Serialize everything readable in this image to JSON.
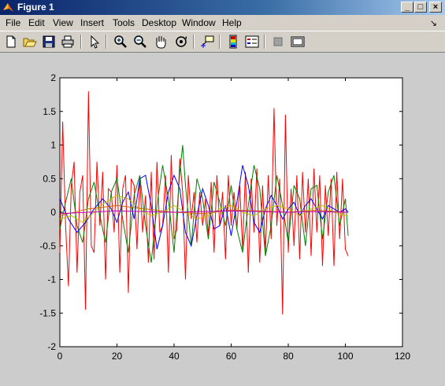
{
  "window": {
    "title": "Figure 1"
  },
  "menubar": {
    "items": [
      "File",
      "Edit",
      "View",
      "Insert",
      "Tools",
      "Desktop",
      "Window",
      "Help"
    ]
  },
  "toolbar": {
    "tools": [
      "new-figure",
      "open-file",
      "save",
      "print",
      "edit-plot",
      "zoom-in",
      "zoom-out",
      "pan",
      "rotate-3d",
      "data-cursor",
      "insert-colorbar",
      "insert-legend",
      "hide-plot-tools",
      "show-plot-tools"
    ]
  },
  "colors": {
    "blue": "#0000ff",
    "green": "#008000",
    "red": "#ff0000",
    "purple": "#bf00bf",
    "olive": "#bfbf00",
    "orange": "#cc6600"
  },
  "chart_data": {
    "type": "line",
    "title": "",
    "xlabel": "",
    "ylabel": "",
    "xlim": [
      0,
      120
    ],
    "ylim": [
      -2,
      2
    ],
    "x_ticks": [
      "0",
      "20",
      "40",
      "60",
      "80",
      "100",
      "120"
    ],
    "y_ticks": [
      "-2",
      "-1.5",
      "-1",
      "-0.5",
      "0",
      "0.5",
      "1",
      "1.5",
      "2"
    ],
    "grid": false,
    "series": [
      {
        "color": "red",
        "points": [
          [
            0,
            -0.6
          ],
          [
            1,
            1.35
          ],
          [
            2,
            -0.2
          ],
          [
            3,
            -1.1
          ],
          [
            4,
            0.4
          ],
          [
            5,
            0.75
          ],
          [
            6,
            -0.9
          ],
          [
            7,
            0.3
          ],
          [
            8,
            0.55
          ],
          [
            9,
            -1.45
          ],
          [
            10,
            1.8
          ],
          [
            11,
            -0.5
          ],
          [
            12,
            -0.6
          ],
          [
            13,
            0.75
          ],
          [
            14,
            -0.2
          ],
          [
            15,
            0.6
          ],
          [
            16,
            -1.0
          ],
          [
            17,
            0.35
          ],
          [
            18,
            0.3
          ],
          [
            19,
            -0.3
          ],
          [
            20,
            0.7
          ],
          [
            21,
            -0.9
          ],
          [
            22,
            0.35
          ],
          [
            23,
            0.55
          ],
          [
            24,
            -1.2
          ],
          [
            25,
            0.5
          ],
          [
            26,
            0.4
          ],
          [
            27,
            -0.55
          ],
          [
            28,
            0.5
          ],
          [
            29,
            -0.3
          ],
          [
            30,
            0.25
          ],
          [
            31,
            -0.75
          ],
          [
            32,
            0.6
          ],
          [
            33,
            -0.7
          ],
          [
            34,
            0.75
          ],
          [
            35,
            -0.3
          ],
          [
            36,
            -0.2
          ],
          [
            37,
            0.55
          ],
          [
            38,
            -0.9
          ],
          [
            39,
            0.85
          ],
          [
            40,
            -0.4
          ],
          [
            41,
            -0.25
          ],
          [
            42,
            0.8
          ],
          [
            43,
            0.3
          ],
          [
            44,
            -1.0
          ],
          [
            45,
            0.55
          ],
          [
            46,
            -0.1
          ],
          [
            47,
            0.3
          ],
          [
            48,
            -0.45
          ],
          [
            49,
            0.3
          ],
          [
            50,
            -0.2
          ],
          [
            51,
            0.2
          ],
          [
            52,
            -0.35
          ],
          [
            53,
            0.45
          ],
          [
            54,
            -0.6
          ],
          [
            55,
            0.55
          ],
          [
            56,
            -0.2
          ],
          [
            57,
            0.3
          ],
          [
            58,
            -0.7
          ],
          [
            59,
            0.55
          ],
          [
            60,
            -0.2
          ],
          [
            61,
            0.3
          ],
          [
            62,
            -0.25
          ],
          [
            63,
            0.4
          ],
          [
            64,
            -0.55
          ],
          [
            65,
            0.6
          ],
          [
            66,
            -0.9
          ],
          [
            67,
            0.5
          ],
          [
            68,
            -0.3
          ],
          [
            69,
            0.65
          ],
          [
            70,
            -0.75
          ],
          [
            71,
            0.4
          ],
          [
            72,
            -0.6
          ],
          [
            73,
            0.55
          ],
          [
            74,
            -0.4
          ],
          [
            75,
            1.55
          ],
          [
            76,
            -0.2
          ],
          [
            77,
            0.5
          ],
          [
            78,
            -1.52
          ],
          [
            79,
            1.45
          ],
          [
            80,
            -0.6
          ],
          [
            81,
            0.35
          ],
          [
            82,
            -0.5
          ],
          [
            83,
            0.55
          ],
          [
            84,
            -0.7
          ],
          [
            85,
            0.6
          ],
          [
            86,
            -0.3
          ],
          [
            87,
            0.5
          ],
          [
            88,
            -0.65
          ],
          [
            89,
            0.65
          ],
          [
            90,
            -0.3
          ],
          [
            91,
            0.55
          ],
          [
            92,
            -0.8
          ],
          [
            93,
            0.4
          ],
          [
            94,
            -0.35
          ],
          [
            95,
            0.5
          ],
          [
            96,
            -0.8
          ],
          [
            97,
            0.6
          ],
          [
            98,
            -0.4
          ],
          [
            99,
            0.5
          ],
          [
            100,
            -0.55
          ],
          [
            101,
            -0.65
          ]
        ]
      },
      {
        "color": "green",
        "points": [
          [
            0,
            -0.25
          ],
          [
            2,
            0.15
          ],
          [
            4,
            0.5
          ],
          [
            6,
            -0.2
          ],
          [
            8,
            -0.45
          ],
          [
            10,
            0.2
          ],
          [
            12,
            0.45
          ],
          [
            14,
            -0.05
          ],
          [
            16,
            -0.45
          ],
          [
            18,
            0.3
          ],
          [
            20,
            0.5
          ],
          [
            22,
            -0.1
          ],
          [
            24,
            -0.6
          ],
          [
            26,
            0.25
          ],
          [
            28,
            0.55
          ],
          [
            30,
            -0.2
          ],
          [
            32,
            -0.75
          ],
          [
            34,
            0.1
          ],
          [
            36,
            0.7
          ],
          [
            38,
            0.2
          ],
          [
            40,
            -0.6
          ],
          [
            42,
            0.6
          ],
          [
            43,
            1.0
          ],
          [
            44,
            0.4
          ],
          [
            46,
            -0.5
          ],
          [
            48,
            0.5
          ],
          [
            50,
            0.2
          ],
          [
            52,
            -0.4
          ],
          [
            54,
            0.45
          ],
          [
            56,
            0.15
          ],
          [
            58,
            -0.2
          ],
          [
            60,
            0.4
          ],
          [
            62,
            -0.25
          ],
          [
            64,
            -0.6
          ],
          [
            66,
            0.1
          ],
          [
            68,
            0.7
          ],
          [
            70,
            0.35
          ],
          [
            72,
            -0.65
          ],
          [
            74,
            -0.2
          ],
          [
            76,
            0.55
          ],
          [
            78,
            0.1
          ],
          [
            80,
            -0.45
          ],
          [
            82,
            0.4
          ],
          [
            84,
            0.2
          ],
          [
            86,
            -0.5
          ],
          [
            88,
            0.35
          ],
          [
            90,
            0.4
          ],
          [
            92,
            -0.4
          ],
          [
            94,
            0.3
          ],
          [
            96,
            0.55
          ],
          [
            98,
            -0.2
          ],
          [
            100,
            0.2
          ],
          [
            101,
            -0.35
          ]
        ]
      },
      {
        "color": "blue",
        "points": [
          [
            0,
            0.2
          ],
          [
            3,
            -0.1
          ],
          [
            6,
            -0.3
          ],
          [
            9,
            -0.15
          ],
          [
            12,
            0.05
          ],
          [
            15,
            0.2
          ],
          [
            18,
            0.05
          ],
          [
            20,
            -0.15
          ],
          [
            22,
            0.15
          ],
          [
            24,
            0.3
          ],
          [
            26,
            -0.1
          ],
          [
            28,
            0.5
          ],
          [
            30,
            0.55
          ],
          [
            32,
            0.1
          ],
          [
            34,
            -0.55
          ],
          [
            36,
            -0.2
          ],
          [
            38,
            0.3
          ],
          [
            40,
            0.55
          ],
          [
            42,
            0.35
          ],
          [
            44,
            -0.3
          ],
          [
            46,
            -0.5
          ],
          [
            48,
            -0.05
          ],
          [
            50,
            0.35
          ],
          [
            52,
            0.1
          ],
          [
            54,
            -0.25
          ],
          [
            56,
            -0.2
          ],
          [
            58,
            0.1
          ],
          [
            60,
            -0.35
          ],
          [
            62,
            0.15
          ],
          [
            64,
            0.7
          ],
          [
            66,
            0.4
          ],
          [
            68,
            -0.15
          ],
          [
            70,
            -0.3
          ],
          [
            72,
            0.05
          ],
          [
            74,
            0.25
          ],
          [
            76,
            0.1
          ],
          [
            78,
            -0.1
          ],
          [
            80,
            0.05
          ],
          [
            82,
            0.15
          ],
          [
            84,
            -0.05
          ],
          [
            86,
            0.1
          ],
          [
            88,
            0.2
          ],
          [
            90,
            0.05
          ],
          [
            92,
            -0.1
          ],
          [
            94,
            0.1
          ],
          [
            96,
            0.05
          ],
          [
            98,
            0.0
          ],
          [
            100,
            0.05
          ],
          [
            101,
            0.0
          ]
        ]
      },
      {
        "color": "olive",
        "points": [
          [
            0,
            -0.1
          ],
          [
            4,
            -0.05
          ],
          [
            8,
            -0.15
          ],
          [
            12,
            0.0
          ],
          [
            16,
            0.15
          ],
          [
            20,
            0.25
          ],
          [
            24,
            0.2
          ],
          [
            28,
            0.05
          ],
          [
            32,
            -0.05
          ],
          [
            36,
            0.0
          ],
          [
            40,
            0.1
          ],
          [
            44,
            0.0
          ],
          [
            48,
            -0.1
          ],
          [
            52,
            -0.05
          ],
          [
            56,
            0.05
          ],
          [
            60,
            0.1
          ],
          [
            64,
            0.0
          ],
          [
            68,
            -0.05
          ],
          [
            72,
            0.05
          ],
          [
            76,
            0.1
          ],
          [
            80,
            0.05
          ],
          [
            84,
            -0.05
          ],
          [
            88,
            0.05
          ],
          [
            92,
            0.1
          ],
          [
            96,
            0.0
          ],
          [
            100,
            -0.05
          ],
          [
            101,
            -0.05
          ]
        ]
      },
      {
        "color": "orange",
        "points": [
          [
            0,
            -0.05
          ],
          [
            10,
            0.05
          ],
          [
            20,
            0.1
          ],
          [
            30,
            0.05
          ],
          [
            40,
            0.0
          ],
          [
            50,
            -0.02
          ],
          [
            60,
            0.03
          ],
          [
            70,
            0.02
          ],
          [
            80,
            0.0
          ],
          [
            90,
            0.03
          ],
          [
            100,
            0.0
          ],
          [
            101,
            0.0
          ]
        ]
      },
      {
        "color": "purple",
        "points": [
          [
            0,
            -0.02
          ],
          [
            10,
            0.0
          ],
          [
            20,
            0.02
          ],
          [
            30,
            0.01
          ],
          [
            40,
            0.0
          ],
          [
            50,
            0.01
          ],
          [
            60,
            0.02
          ],
          [
            70,
            0.01
          ],
          [
            80,
            0.0
          ],
          [
            90,
            0.01
          ],
          [
            100,
            0.0
          ],
          [
            101,
            0.0
          ]
        ]
      }
    ]
  }
}
